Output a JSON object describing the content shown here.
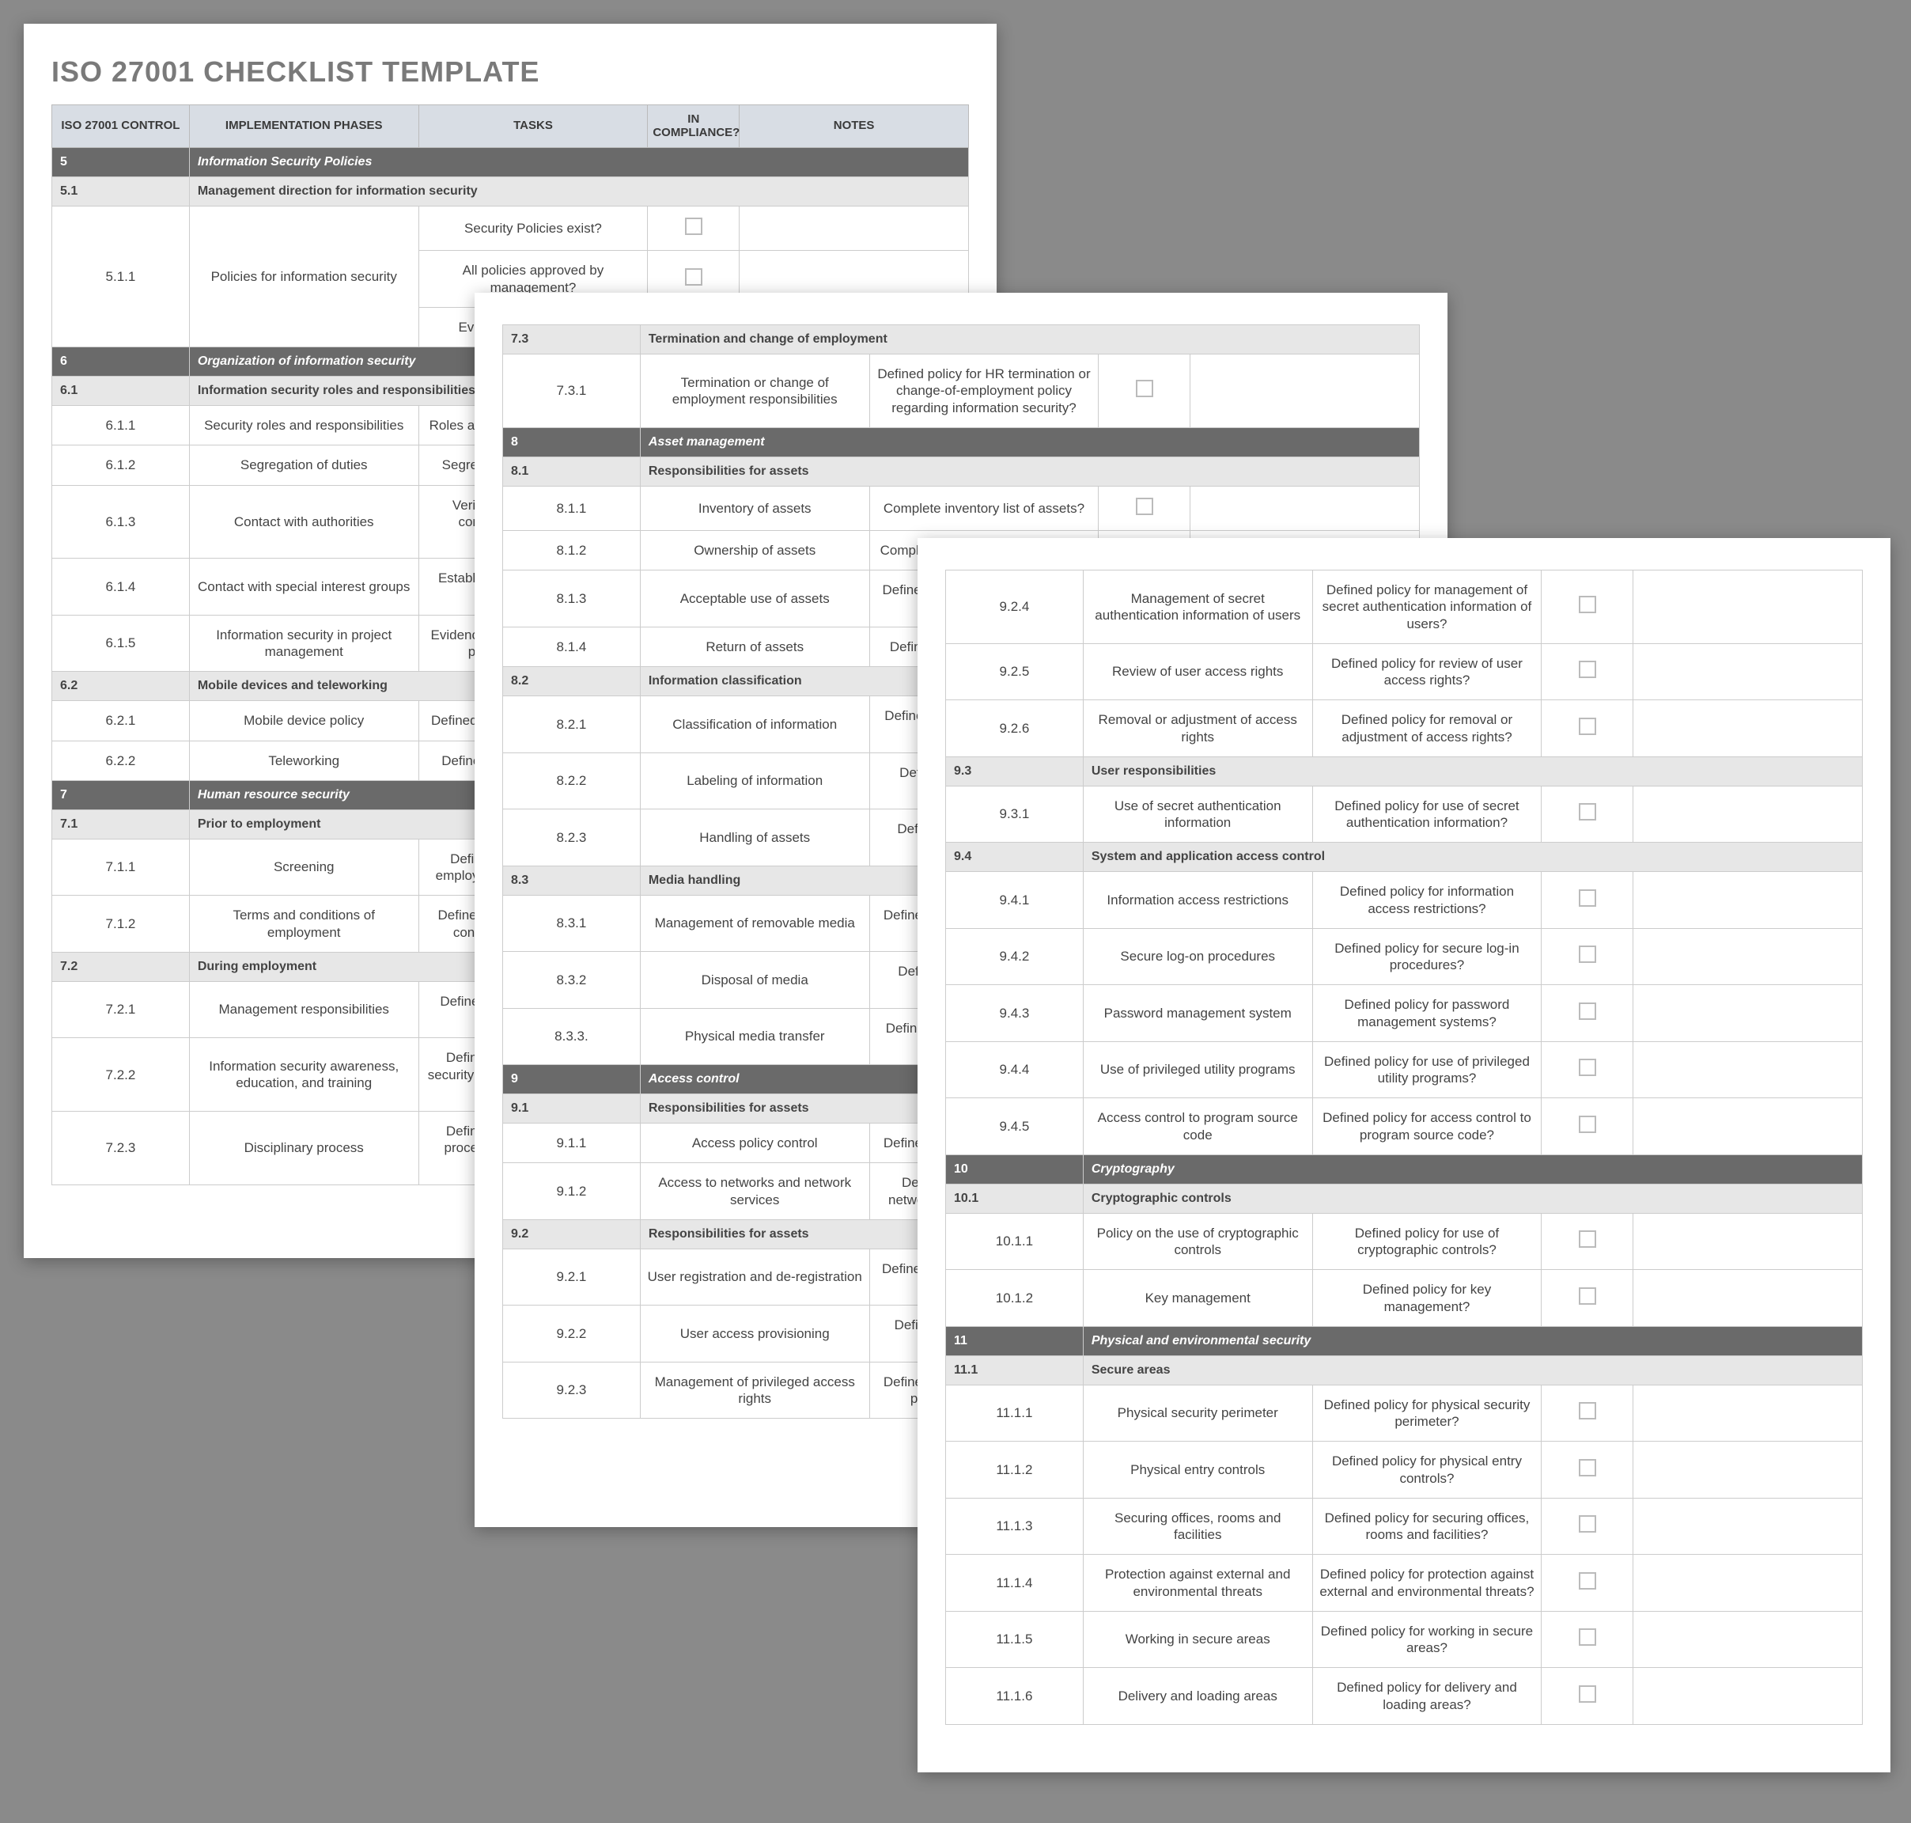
{
  "title": "ISO 27001 CHECKLIST TEMPLATE",
  "headers": {
    "control": "ISO 27001 CONTROL",
    "phases": "IMPLEMENTATION PHASES",
    "tasks": "TASKS",
    "compliance": "IN COMPLIANCE?",
    "notes": "NOTES"
  },
  "page1": [
    {
      "type": "section",
      "num": "5",
      "label": "Information Security Policies"
    },
    {
      "type": "subsection",
      "num": "5.1",
      "label": "Management direction for information security"
    },
    {
      "type": "row",
      "num": "5.1.1",
      "phase": "Policies for information security",
      "task": "Security Policies exist?",
      "cb": true,
      "rowspan": 3
    },
    {
      "type": "subrow",
      "task": "All policies approved by management?",
      "cb": true
    },
    {
      "type": "subrow",
      "task": "Evidence of compliance?",
      "cb": false
    },
    {
      "type": "section",
      "num": "6",
      "label": "Organization of information security"
    },
    {
      "type": "subsection",
      "num": "6.1",
      "label": "Information security roles and responsibilities"
    },
    {
      "type": "row",
      "num": "6.1.1",
      "phase": "Security roles and responsibilities",
      "task": "Roles and responsibilities defined?"
    },
    {
      "type": "row",
      "num": "6.1.2",
      "phase": "Segregation of duties",
      "task": "Segregation of duties defined?"
    },
    {
      "type": "row",
      "num": "6.1.3",
      "phase": "Contact with authorities",
      "task": "Verification body / authority contacted for compliance verification?"
    },
    {
      "type": "row",
      "num": "6.1.4",
      "phase": "Contact with special interest groups",
      "task": "Established contact with special interest groups?"
    },
    {
      "type": "row",
      "num": "6.1.5",
      "phase": "Information security in project management",
      "task": "Evidence of information security in project management?"
    },
    {
      "type": "subsection",
      "num": "6.2",
      "label": "Mobile devices and teleworking"
    },
    {
      "type": "row",
      "num": "6.2.1",
      "phase": "Mobile device policy",
      "task": "Defined policy for mobile devices?"
    },
    {
      "type": "row",
      "num": "6.2.2",
      "phase": "Teleworking",
      "task": "Defined policy for teleworking?"
    },
    {
      "type": "section",
      "num": "7",
      "label": "Human resource security"
    },
    {
      "type": "subsection",
      "num": "7.1",
      "label": "Prior to employment"
    },
    {
      "type": "row",
      "num": "7.1.1",
      "phase": "Screening",
      "task": "Defined policy for screening employees prior to employment?"
    },
    {
      "type": "row",
      "num": "7.1.2",
      "phase": "Terms and conditions of employment",
      "task": "Defined policy for HR terms and conditions of employment?"
    },
    {
      "type": "subsection",
      "num": "7.2",
      "label": "During employment"
    },
    {
      "type": "row",
      "num": "7.2.1",
      "phase": "Management responsibilities",
      "task": "Defined policy for management responsibilities?"
    },
    {
      "type": "row",
      "num": "7.2.2",
      "phase": "Information security awareness, education, and training",
      "task": "Defined policy for information security awareness, education, and training?"
    },
    {
      "type": "row",
      "num": "7.2.3",
      "phase": "Disciplinary process",
      "task": "Defined policy for disciplinary process regarding information security?"
    }
  ],
  "page2": [
    {
      "type": "subsection",
      "num": "7.3",
      "label": "Termination and change of employment"
    },
    {
      "type": "row",
      "num": "7.3.1",
      "phase": "Termination or change of employment responsibilities",
      "task": "Defined policy for HR termination or change-of-employment policy regarding information security?",
      "cb": true
    },
    {
      "type": "section",
      "num": "8",
      "label": "Asset management"
    },
    {
      "type": "subsection",
      "num": "8.1",
      "label": "Responsibilities for assets"
    },
    {
      "type": "row",
      "num": "8.1.1",
      "phase": "Inventory of assets",
      "task": "Complete inventory list of assets?",
      "cb": true
    },
    {
      "type": "row",
      "num": "8.1.2",
      "phase": "Ownership of assets",
      "task": "Complete ownership list of assets?"
    },
    {
      "type": "row",
      "num": "8.1.3",
      "phase": "Acceptable use of assets",
      "task": "Defined 'acceptable use' of assets policy?"
    },
    {
      "type": "row",
      "num": "8.1.4",
      "phase": "Return of assets",
      "task": "Defined return of assets policy?"
    },
    {
      "type": "subsection",
      "num": "8.2",
      "label": "Information classification"
    },
    {
      "type": "row",
      "num": "8.2.1",
      "phase": "Classification of information",
      "task": "Defined policy for classification of information?"
    },
    {
      "type": "row",
      "num": "8.2.2",
      "phase": "Labeling of information",
      "task": "Defined policy for labeling of information?"
    },
    {
      "type": "row",
      "num": "8.2.3",
      "phase": "Handling of assets",
      "task": "Defined policy for handling of assets?"
    },
    {
      "type": "subsection",
      "num": "8.3",
      "label": "Media handling"
    },
    {
      "type": "row",
      "num": "8.3.1",
      "phase": "Management of removable media",
      "task": "Defined policy for management of removable media?"
    },
    {
      "type": "row",
      "num": "8.3.2",
      "phase": "Disposal of media",
      "task": "Defined policy for disposal of media?"
    },
    {
      "type": "row",
      "num": "8.3.3.",
      "phase": "Physical media transfer",
      "task": "Defined policy for physical media transfer?"
    },
    {
      "type": "section",
      "num": "9",
      "label": "Access control"
    },
    {
      "type": "subsection",
      "num": "9.1",
      "label": "Responsibilities for assets"
    },
    {
      "type": "row",
      "num": "9.1.1",
      "phase": "Access policy control",
      "task": "Defined policy for access control?"
    },
    {
      "type": "row",
      "num": "9.1.2",
      "phase": "Access to networks and network services",
      "task": "Defined policy for access to networks and network services?"
    },
    {
      "type": "subsection",
      "num": "9.2",
      "label": "Responsibilities for assets"
    },
    {
      "type": "row",
      "num": "9.2.1",
      "phase": "User registration and de-registration",
      "task": "Defined policy for user registration and de-registration?"
    },
    {
      "type": "row",
      "num": "9.2.2",
      "phase": "User access provisioning",
      "task": "Defined policy for user access provisioning?"
    },
    {
      "type": "row",
      "num": "9.2.3",
      "phase": "Management of privileged access rights",
      "task": "Defined policy for management of privileged access rights?"
    }
  ],
  "page3": [
    {
      "type": "row",
      "num": "9.2.4",
      "phase": "Management of secret authentication information of users",
      "task": "Defined policy for management of secret authentication information of users?",
      "cb": true
    },
    {
      "type": "row",
      "num": "9.2.5",
      "phase": "Review of user access rights",
      "task": "Defined policy for review of user access rights?",
      "cb": true
    },
    {
      "type": "row",
      "num": "9.2.6",
      "phase": "Removal or adjustment of access rights",
      "task": "Defined policy for removal or adjustment of access rights?",
      "cb": true
    },
    {
      "type": "subsection",
      "num": "9.3",
      "label": "User responsibilities"
    },
    {
      "type": "row",
      "num": "9.3.1",
      "phase": "Use of secret authentication information",
      "task": "Defined policy for use of secret authentication information?",
      "cb": true
    },
    {
      "type": "subsection",
      "num": "9.4",
      "label": "System and application access control"
    },
    {
      "type": "row",
      "num": "9.4.1",
      "phase": "Information access restrictions",
      "task": "Defined policy for information access restrictions?",
      "cb": true
    },
    {
      "type": "row",
      "num": "9.4.2",
      "phase": "Secure log-on procedures",
      "task": "Defined policy for secure log-in procedures?",
      "cb": true
    },
    {
      "type": "row",
      "num": "9.4.3",
      "phase": "Password management system",
      "task": "Defined policy for password management systems?",
      "cb": true
    },
    {
      "type": "row",
      "num": "9.4.4",
      "phase": "Use of privileged utility programs",
      "task": "Defined policy for use of privileged utility programs?",
      "cb": true
    },
    {
      "type": "row",
      "num": "9.4.5",
      "phase": "Access control to program source code",
      "task": "Defined policy for access control to program source code?",
      "cb": true
    },
    {
      "type": "section",
      "num": "10",
      "label": "Cryptography"
    },
    {
      "type": "subsection",
      "num": "10.1",
      "label": "Cryptographic controls"
    },
    {
      "type": "row",
      "num": "10.1.1",
      "phase": "Policy on the use of cryptographic controls",
      "task": "Defined policy for use of cryptographic controls?",
      "cb": true
    },
    {
      "type": "row",
      "num": "10.1.2",
      "phase": "Key management",
      "task": "Defined policy for key management?",
      "cb": true
    },
    {
      "type": "section",
      "num": "11",
      "label": "Physical and environmental security"
    },
    {
      "type": "subsection",
      "num": "11.1",
      "label": "Secure areas"
    },
    {
      "type": "row",
      "num": "11.1.1",
      "phase": "Physical security perimeter",
      "task": "Defined policy for physical security perimeter?",
      "cb": true
    },
    {
      "type": "row",
      "num": "11.1.2",
      "phase": "Physical entry controls",
      "task": "Defined policy for physical entry controls?",
      "cb": true
    },
    {
      "type": "row",
      "num": "11.1.3",
      "phase": "Securing offices, rooms and facilities",
      "task": "Defined policy for securing offices, rooms and facilities?",
      "cb": true
    },
    {
      "type": "row",
      "num": "11.1.4",
      "phase": "Protection against external and environmental threats",
      "task": "Defined policy for protection against external and environmental threats?",
      "cb": true
    },
    {
      "type": "row",
      "num": "11.1.5",
      "phase": "Working in secure areas",
      "task": "Defined policy for working in secure areas?",
      "cb": true
    },
    {
      "type": "row",
      "num": "11.1.6",
      "phase": "Delivery and loading areas",
      "task": "Defined policy for delivery and loading areas?",
      "cb": true
    }
  ]
}
